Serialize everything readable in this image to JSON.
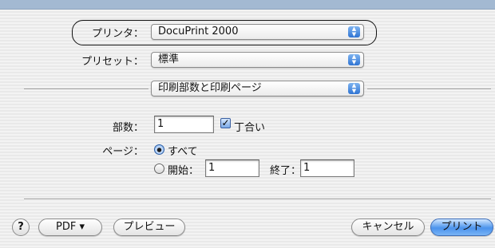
{
  "printer": {
    "label": "プリンタ：",
    "value": "DocuPrint 2000"
  },
  "presets": {
    "label": "プリセット：",
    "value": "標準"
  },
  "pane": {
    "value": "印刷部数と印刷ページ"
  },
  "copies": {
    "label": "部数：",
    "value": "1",
    "collate_label": "丁合い",
    "collate_checked": true
  },
  "pages": {
    "label": "ページ：",
    "all_label": "すべて",
    "from_label": "開始：",
    "from_value": "1",
    "to_label": "終了：",
    "to_value": "1",
    "selected": "all"
  },
  "buttons": {
    "help": "?",
    "pdf": "PDF ▾",
    "preview": "プレビュー",
    "cancel": "キャンセル",
    "print": "プリント"
  },
  "icons": {
    "popup_arrows": "up-down-arrows-icon",
    "check": "checkmark-icon",
    "help": "question-icon"
  }
}
